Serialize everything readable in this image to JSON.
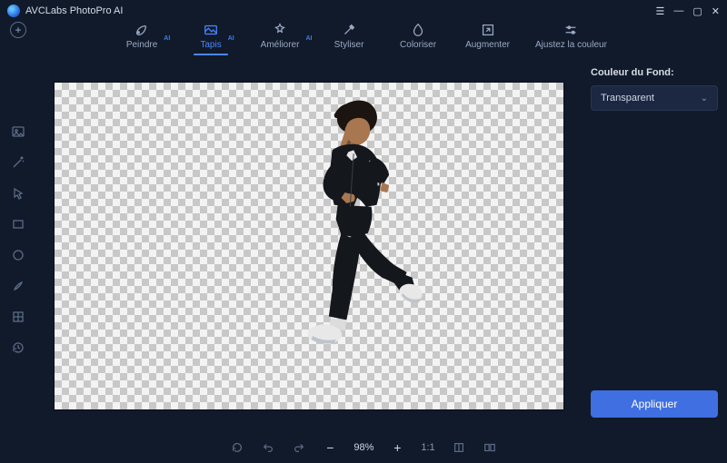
{
  "app": {
    "title": "AVCLabs PhotoPro AI"
  },
  "tabs": [
    {
      "id": "paint",
      "label": "Peindre",
      "ai": true,
      "active": false
    },
    {
      "id": "tapis",
      "label": "Tapis",
      "ai": true,
      "active": true
    },
    {
      "id": "enhance",
      "label": "Améliorer",
      "ai": true,
      "active": false
    },
    {
      "id": "stylize",
      "label": "Styliser",
      "ai": false,
      "active": false
    },
    {
      "id": "colorize",
      "label": "Coloriser",
      "ai": false,
      "active": false
    },
    {
      "id": "upscale",
      "label": "Augmenter",
      "ai": false,
      "active": false
    },
    {
      "id": "adjust",
      "label": "Ajustez la couleur",
      "ai": false,
      "active": false
    }
  ],
  "ai_badge": "AI",
  "right_panel": {
    "title": "Couleur du Fond:",
    "selected": "Transparent",
    "apply": "Appliquer"
  },
  "bottom": {
    "zoom": "98%",
    "ratio_label": "1:1"
  },
  "colors": {
    "accent": "#3f6fe0",
    "active": "#4a86ff"
  },
  "subject": {
    "description": "man-running-cutout",
    "skin": "#a9774f",
    "hair": "#1c1410",
    "jacket": "#14171c",
    "pants": "#14171c",
    "shoes": "#e8e8e8"
  }
}
